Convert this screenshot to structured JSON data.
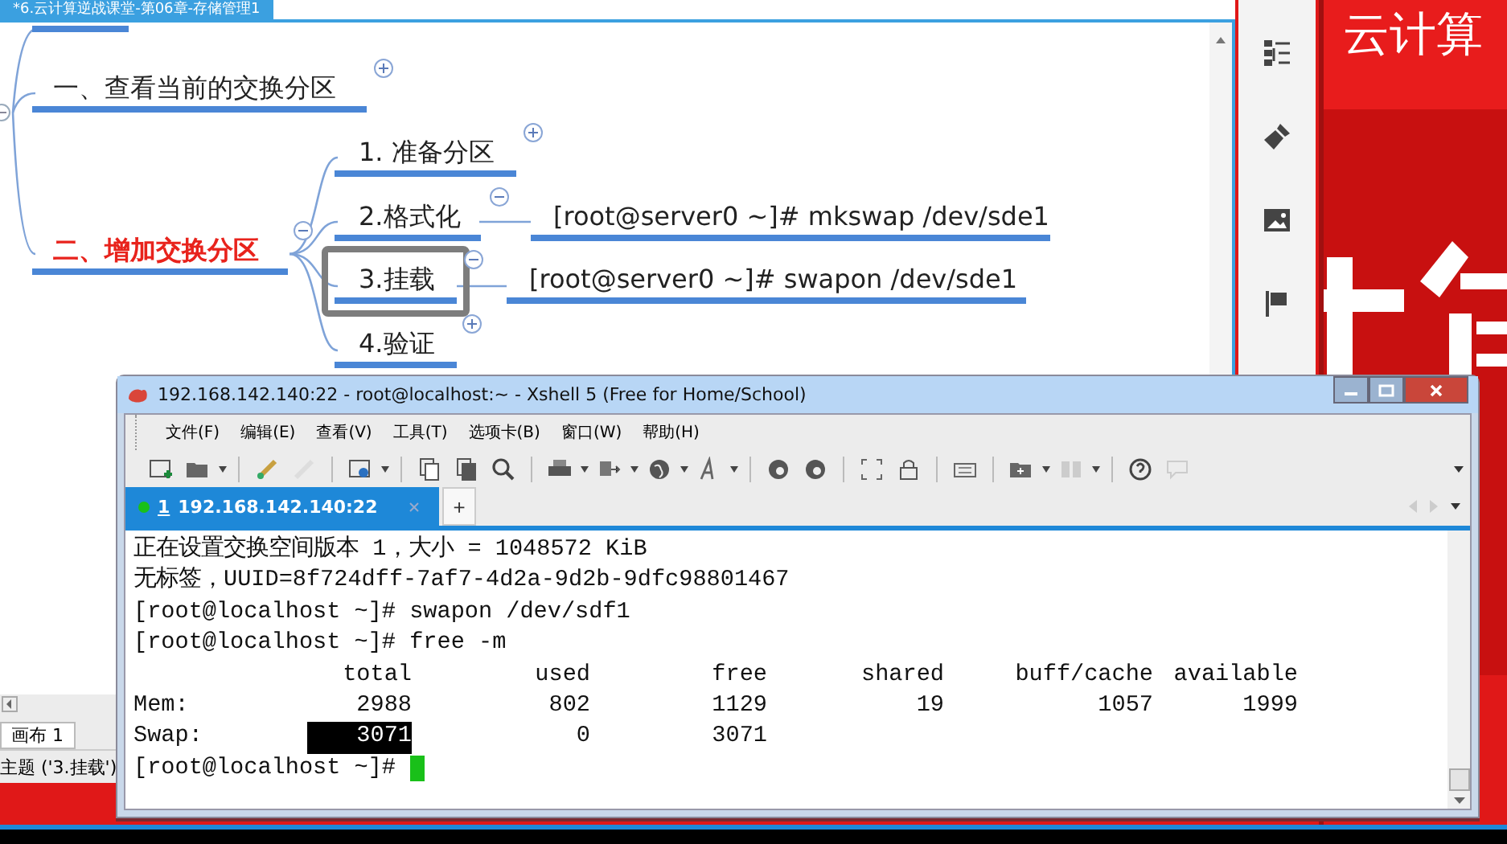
{
  "mindmap": {
    "tab_title": "*6.云计算逆战课堂-第06章-存储管理1",
    "topics": [
      {
        "label": "一、查看当前的交换分区",
        "emphasized": false,
        "expanded": false
      },
      {
        "label": "二、增加交换分区",
        "emphasized": true,
        "expanded": true,
        "children": [
          {
            "label": "1. 准备分区",
            "selected": false,
            "expanded": false
          },
          {
            "label": "2.格式化",
            "selected": false,
            "expanded": true,
            "children": [
              {
                "label": "[root@server0 ~]# mkswap /dev/sde1"
              }
            ]
          },
          {
            "label": "3.挂载",
            "selected": true,
            "expanded": true,
            "children": [
              {
                "label": "[root@server0 ~]# swapon /dev/sde1"
              }
            ]
          },
          {
            "label": "4.验证",
            "selected": false,
            "expanded": false
          }
        ]
      }
    ],
    "sheet_tab": "画布 1",
    "status": "主题 ('3.挂载')"
  },
  "banner": {
    "title": "云计算"
  },
  "xshell": {
    "title": "192.168.142.140:22 - root@localhost:~ - Xshell 5 (Free for Home/School)",
    "menu": [
      "文件(F)",
      "编辑(E)",
      "查看(V)",
      "工具(T)",
      "选项卡(B)",
      "窗口(W)",
      "帮助(H)"
    ],
    "tabs": [
      {
        "number": "1",
        "label": "192.168.142.140:22",
        "selected": true,
        "connected": true
      }
    ],
    "add_tab": "+",
    "terminal": {
      "lines": [
        "正在设置交换空间版本 1，大小 = 1048572 KiB",
        "无标签，UUID=8f724dff-7af7-4d2a-9d2b-9dfc98801467",
        "[root@localhost ~]# swapon /dev/sdf1",
        "[root@localhost ~]# free -m"
      ],
      "free_table": {
        "columns": [
          "total",
          "used",
          "free",
          "shared",
          "buff/cache",
          "available"
        ],
        "rows": [
          {
            "label": "Mem:",
            "cells": [
              {
                "text": "2988",
                "selected": false
              },
              {
                "text": "802",
                "selected": false
              },
              {
                "text": "1129",
                "selected": false
              },
              {
                "text": "19",
                "selected": false
              },
              {
                "text": "1057",
                "selected": false
              },
              {
                "text": "1999",
                "selected": false
              }
            ]
          },
          {
            "label": "Swap:",
            "cells": [
              {
                "text": "3071",
                "selected": true
              },
              {
                "text": "0",
                "selected": false
              },
              {
                "text": "3071",
                "selected": false
              }
            ]
          }
        ]
      },
      "prompt": "[root@localhost ~]#",
      "cursor": true
    }
  }
}
